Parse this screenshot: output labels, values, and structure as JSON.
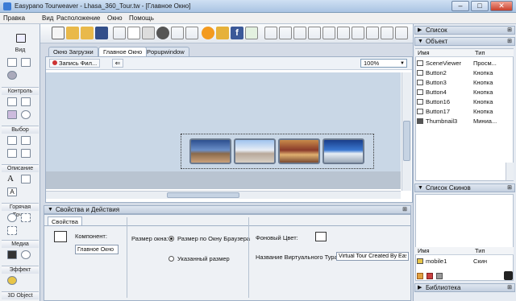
{
  "window": {
    "title": "Easypano Tourweaver - Lhasa_360_Tour.tw - [Главное Окно]"
  },
  "menu": [
    "Правка",
    "Вид",
    "Расположение",
    "Окно",
    "Помощь"
  ],
  "left_panel": {
    "sections": [
      "Вид",
      "Контроль",
      "Выбор",
      "Описание",
      "Горячая Точка",
      "Медиа",
      "Эффект",
      "3D Object"
    ]
  },
  "tabs": [
    {
      "label": "Окно Загрузки",
      "active": false
    },
    {
      "label": "Главное Окно",
      "active": true
    },
    {
      "label": "Popupwindow",
      "active": false
    }
  ],
  "doc_toolbar": {
    "record_label": "Запись Фил...",
    "zoom": "100%"
  },
  "properties": {
    "header": "Свойства и Действия",
    "tab": "Свойства",
    "component_label": "Компонент:",
    "component_value": "Главное Окно",
    "window_size_label": "Размер окна:",
    "size_option_browser": "Размер по Окну Браузера",
    "size_option_custom": "Указанный размер",
    "bg_color_label": "Фоновый Цвет:",
    "virtual_tour_name_label": "Название Виртуального Тура:",
    "virtual_tour_name_value": "Virtual Tour Created By Easy"
  },
  "right_panel": {
    "list_header": "Список",
    "object_header": "Объект",
    "object_columns": [
      "Имя",
      "Тип"
    ],
    "objects": [
      {
        "name": "SceneViewer",
        "type": "Просм..."
      },
      {
        "name": "Button2",
        "type": "Кнопка"
      },
      {
        "name": "Button3",
        "type": "Кнопка"
      },
      {
        "name": "Button4",
        "type": "Кнопка"
      },
      {
        "name": "Button16",
        "type": "Кнопка"
      },
      {
        "name": "Button17",
        "type": "Кнопка"
      },
      {
        "name": "Thumbnail3",
        "type": "Миниа..."
      }
    ],
    "skins_header": "Список Скинов",
    "skins_columns": [
      "Имя",
      "Тип"
    ],
    "skins": [
      {
        "name": "mobile1",
        "type": "Скин"
      }
    ],
    "library_header": "Библиотека"
  },
  "colors": {
    "accent": "#3a7bd5",
    "canvas": "#c9d7e6",
    "panel": "#e6ebf2"
  }
}
